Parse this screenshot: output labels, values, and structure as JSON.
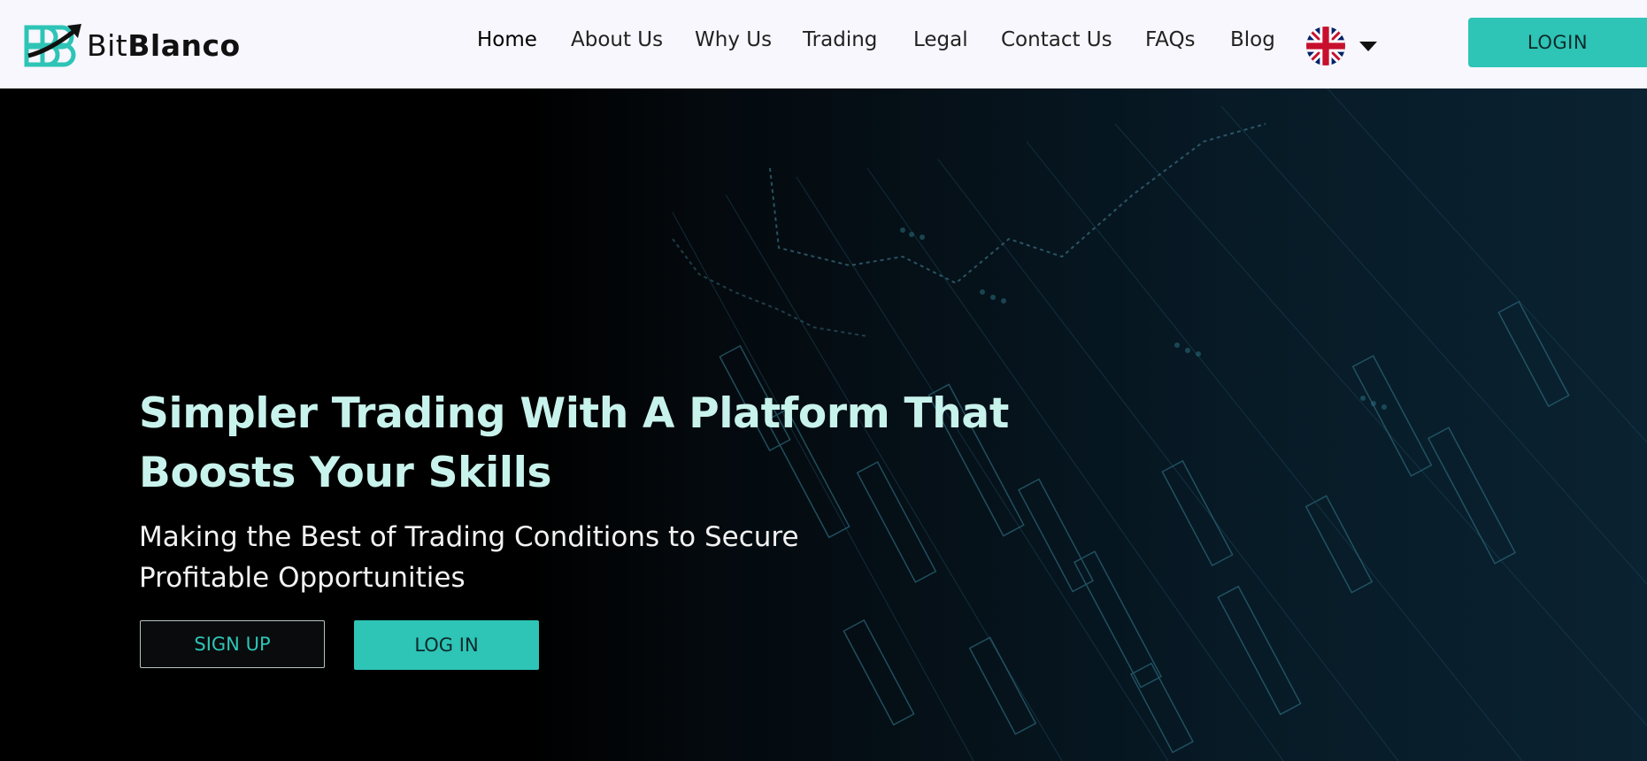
{
  "brand": {
    "name_light": "Bit",
    "name_bold": "Blanco",
    "logo_icon": "bb-arrow-logo-icon"
  },
  "nav": {
    "items": [
      {
        "label": "Home",
        "active": true
      },
      {
        "label": "About Us"
      },
      {
        "label": "Why Us"
      },
      {
        "label": "Trading"
      },
      {
        "label": "Legal"
      },
      {
        "label": "Contact Us"
      },
      {
        "label": "FAQs"
      },
      {
        "label": "Blog"
      }
    ],
    "language_icon": "uk-flag-icon",
    "dropdown_icon": "caret-down-icon",
    "login_label": "LOGIN"
  },
  "hero": {
    "headline_line1": "Simpler Trading With A Platform That",
    "headline_line2": "Boosts Your Skills",
    "subhead_line1": "Making the Best of Trading Conditions to Secure",
    "subhead_line2": "Profitable Opportunities",
    "signup_label": "SIGN UP",
    "login_label": "LOG IN"
  },
  "colors": {
    "accent": "#2ec4b6",
    "headline": "#c8f3ec",
    "nav_background": "#f7f7fd",
    "hero_background": "#000000"
  }
}
